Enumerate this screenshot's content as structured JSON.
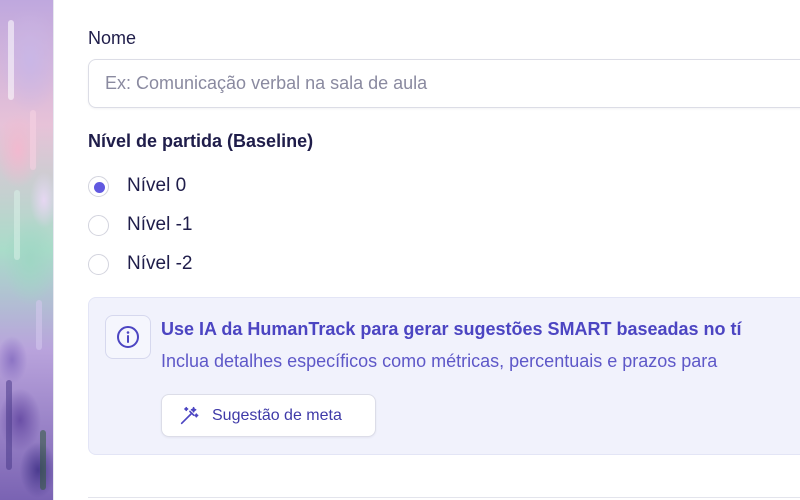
{
  "form": {
    "name_label": "Nome",
    "name_placeholder": "Ex: Comunicação verbal na sala de aula",
    "name_value": "",
    "baseline_label": "Nível de partida (Baseline)",
    "baseline_options": [
      {
        "label": "Nível 0",
        "checked": true
      },
      {
        "label": "Nível -1",
        "checked": false
      },
      {
        "label": "Nível -2",
        "checked": false
      }
    ]
  },
  "ai_panel": {
    "icon": "info-icon",
    "title": "Use IA da HumanTrack para gerar sugestões SMART baseadas no tí",
    "description": "Inclua detalhes específicos como métricas, percentuais e prazos para",
    "button_label": "Sugestão de meta",
    "button_icon": "magic-wand-icon"
  },
  "colors": {
    "accent": "#6159e0",
    "panel_bg": "#f1f2fc",
    "panel_text": "#4c45c2",
    "heading_text": "#1f1d4a"
  }
}
